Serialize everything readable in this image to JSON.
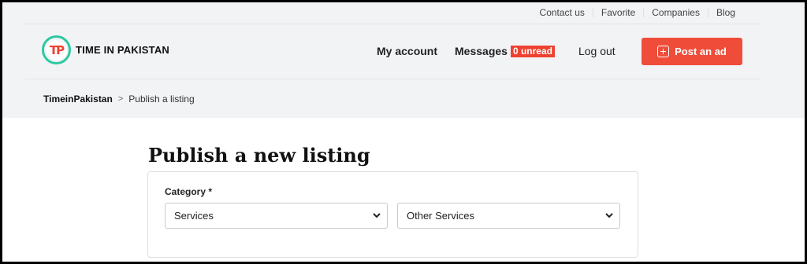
{
  "topbar": {
    "links": [
      "Contact us",
      "Favorite",
      "Companies",
      "Blog"
    ]
  },
  "brand": {
    "logo_initials": "TP",
    "name": "TIME IN PAKISTAN"
  },
  "nav": {
    "my_account": "My account",
    "messages": "Messages",
    "unread_badge": "0 unread",
    "logout": "Log out",
    "post_ad": "Post an ad"
  },
  "breadcrumb": {
    "home": "TimeinPakistan",
    "separator": ">",
    "current": "Publish a listing"
  },
  "page": {
    "title": "Publish a new listing"
  },
  "form": {
    "category_label": "Category *",
    "category_value": "Services",
    "subcategory_value": "Other Services"
  },
  "colors": {
    "accent": "#ef4d3a",
    "badge": "#ef4130",
    "logo_ring": "#2cc9a0"
  }
}
